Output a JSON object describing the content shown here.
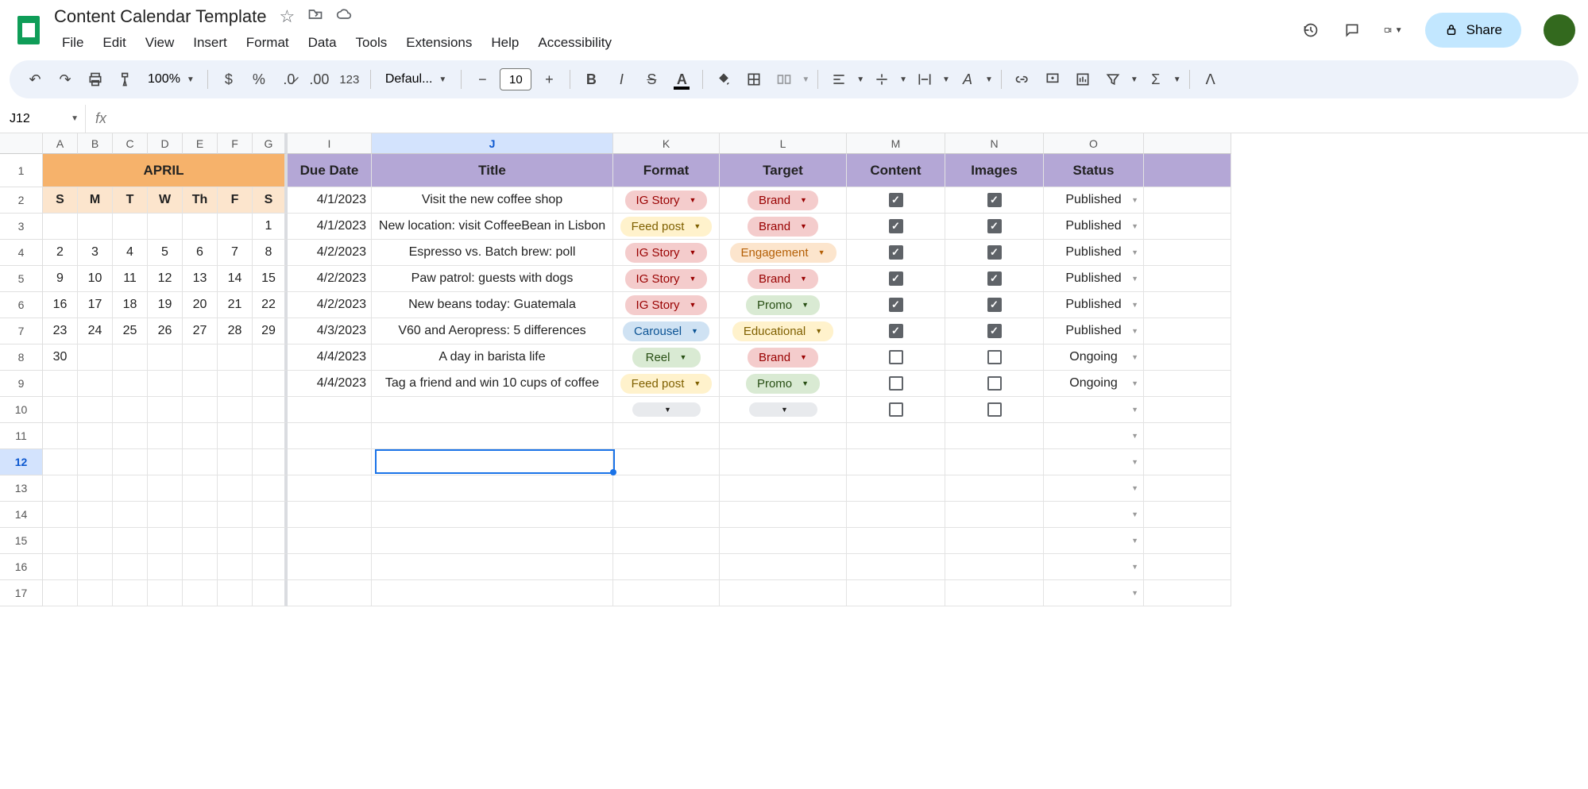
{
  "doc": {
    "title": "Content Calendar Template"
  },
  "menu": [
    "File",
    "Edit",
    "View",
    "Insert",
    "Format",
    "Data",
    "Tools",
    "Extensions",
    "Help",
    "Accessibility"
  ],
  "share": "Share",
  "zoom": "100%",
  "font": "Defaul...",
  "fontSize": "10",
  "nameBox": "J12",
  "month": "APRIL",
  "weekdays": [
    "S",
    "M",
    "T",
    "W",
    "Th",
    "F",
    "S"
  ],
  "calendar": [
    [
      "",
      "",
      "",
      "",
      "",
      "",
      "1"
    ],
    [
      "2",
      "3",
      "4",
      "5",
      "6",
      "7",
      "8"
    ],
    [
      "9",
      "10",
      "11",
      "12",
      "13",
      "14",
      "15"
    ],
    [
      "16",
      "17",
      "18",
      "19",
      "20",
      "21",
      "22"
    ],
    [
      "23",
      "24",
      "25",
      "26",
      "27",
      "28",
      "29"
    ],
    [
      "30",
      "",
      "",
      "",
      "",
      "",
      ""
    ],
    [
      "",
      "",
      "",
      "",
      "",
      "",
      ""
    ]
  ],
  "cols_small": [
    "A",
    "B",
    "C",
    "D",
    "E",
    "F",
    "G"
  ],
  "cols_main": [
    "I",
    "J",
    "K",
    "L",
    "M",
    "N",
    "O"
  ],
  "headers": [
    "Due Date",
    "Title",
    "Format",
    "Target",
    "Content",
    "Images",
    "Status"
  ],
  "rows": [
    {
      "date": "4/1/2023",
      "title": "Visit the new coffee shop",
      "format": "IG Story",
      "fclass": "chip-ig",
      "target": "Brand",
      "tclass": "chip-brand",
      "content": true,
      "images": true,
      "status": "Published"
    },
    {
      "date": "4/1/2023",
      "title": "New location: visit CoffeeBean in Lisbon",
      "format": "Feed post",
      "fclass": "chip-feed",
      "target": "Brand",
      "tclass": "chip-brand",
      "content": true,
      "images": true,
      "status": "Published"
    },
    {
      "date": "4/2/2023",
      "title": "Espresso vs. Batch brew: poll",
      "format": "IG Story",
      "fclass": "chip-ig",
      "target": "Engagement",
      "tclass": "chip-engage",
      "content": true,
      "images": true,
      "status": "Published"
    },
    {
      "date": "4/2/2023",
      "title": "Paw patrol: guests with dogs",
      "format": "IG Story",
      "fclass": "chip-ig",
      "target": "Brand",
      "tclass": "chip-brand",
      "content": true,
      "images": true,
      "status": "Published"
    },
    {
      "date": "4/2/2023",
      "title": "New beans today: Guatemala",
      "format": "IG Story",
      "fclass": "chip-ig",
      "target": "Promo",
      "tclass": "chip-promo",
      "content": true,
      "images": true,
      "status": "Published"
    },
    {
      "date": "4/3/2023",
      "title": "V60 and Aeropress: 5 differences",
      "format": "Carousel",
      "fclass": "chip-carousel",
      "target": "Educational",
      "tclass": "chip-edu",
      "content": true,
      "images": true,
      "status": "Published"
    },
    {
      "date": "4/4/2023",
      "title": "A day in barista life",
      "format": "Reel",
      "fclass": "chip-reel",
      "target": "Brand",
      "tclass": "chip-brand",
      "content": false,
      "images": false,
      "status": "Ongoing"
    },
    {
      "date": "4/4/2023",
      "title": "Tag a friend and win 10 cups of coffee",
      "format": "Feed post",
      "fclass": "chip-feed",
      "target": "Promo",
      "tclass": "chip-promo",
      "content": false,
      "images": false,
      "status": "Ongoing"
    },
    {
      "date": "",
      "title": "",
      "format": "",
      "fclass": "chip-empty",
      "target": "",
      "tclass": "chip-empty",
      "content": false,
      "images": false,
      "status": ""
    }
  ],
  "widths": {
    "small": 44,
    "I": 106,
    "J": 304,
    "K": 134,
    "L": 160,
    "M": 124,
    "N": 124,
    "O": 126,
    "blank": 110
  },
  "selectedRow": 12
}
